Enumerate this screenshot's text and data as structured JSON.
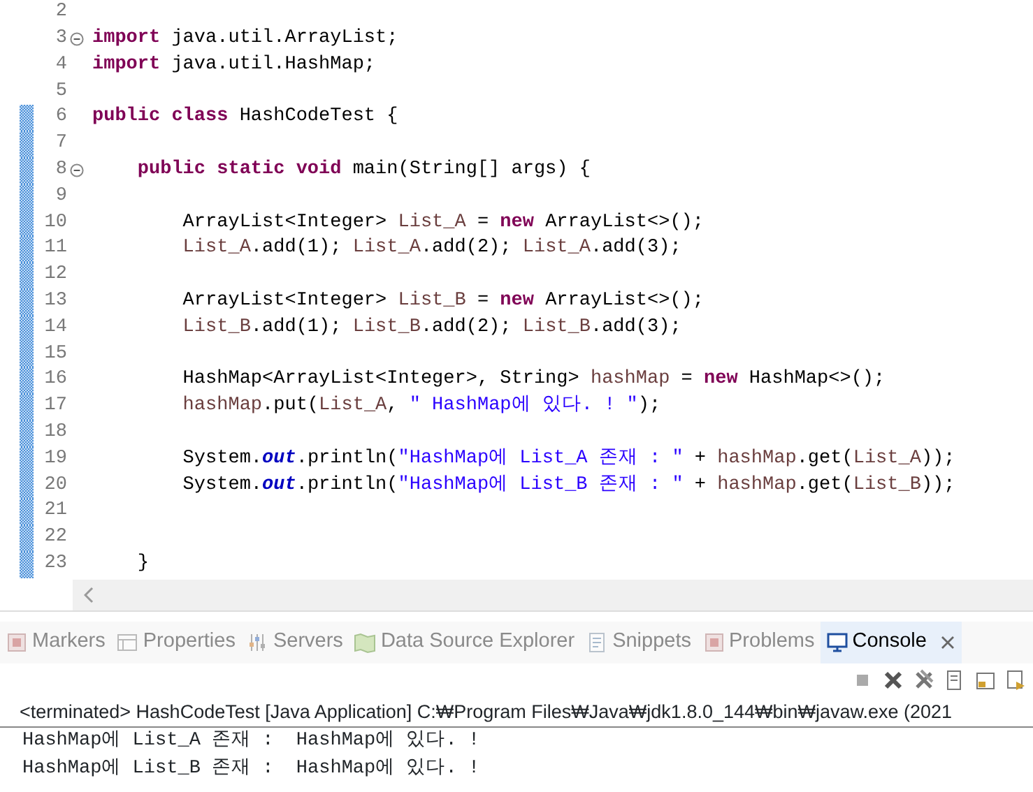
{
  "editor": {
    "lines": [
      {
        "number": "2",
        "fold": false,
        "changed": false
      },
      {
        "number": "3",
        "fold": true,
        "changed": false,
        "tokens": [
          {
            "kind": "keyword",
            "text": "import"
          },
          {
            "kind": "plain",
            "text": " java.util.ArrayList;"
          }
        ]
      },
      {
        "number": "4",
        "fold": false,
        "changed": false,
        "tokens": [
          {
            "kind": "keyword",
            "text": "import"
          },
          {
            "kind": "plain",
            "text": " java.util.HashMap;"
          }
        ]
      },
      {
        "number": "5",
        "fold": false,
        "changed": false
      },
      {
        "number": "6",
        "fold": false,
        "changed": true,
        "tokens": [
          {
            "kind": "keyword",
            "text": "public class"
          },
          {
            "kind": "plain",
            "text": " HashCodeTest {"
          }
        ]
      },
      {
        "number": "7",
        "fold": false,
        "changed": true
      },
      {
        "number": "8",
        "fold": true,
        "changed": true,
        "tokens": [
          {
            "kind": "keyword",
            "text": "    public static void"
          },
          {
            "kind": "plain",
            "text": " main(String[] args) {"
          }
        ]
      },
      {
        "number": "9",
        "fold": false,
        "changed": true
      },
      {
        "number": "10",
        "fold": false,
        "changed": true,
        "tokens": [
          {
            "kind": "plain",
            "text": "        ArrayList<Integer> "
          },
          {
            "kind": "variable",
            "text": "List_A"
          },
          {
            "kind": "plain",
            "text": " = "
          },
          {
            "kind": "keyword",
            "text": "new"
          },
          {
            "kind": "plain",
            "text": " ArrayList<>();"
          }
        ]
      },
      {
        "number": "11",
        "fold": false,
        "changed": true,
        "tokens": [
          {
            "kind": "variable",
            "text": "        List_A"
          },
          {
            "kind": "plain",
            "text": ".add(1); "
          },
          {
            "kind": "variable",
            "text": "List_A"
          },
          {
            "kind": "plain",
            "text": ".add(2); "
          },
          {
            "kind": "variable",
            "text": "List_A"
          },
          {
            "kind": "plain",
            "text": ".add(3);"
          }
        ]
      },
      {
        "number": "12",
        "fold": false,
        "changed": true
      },
      {
        "number": "13",
        "fold": false,
        "changed": true,
        "tokens": [
          {
            "kind": "plain",
            "text": "        ArrayList<Integer> "
          },
          {
            "kind": "variable",
            "text": "List_B"
          },
          {
            "kind": "plain",
            "text": " = "
          },
          {
            "kind": "keyword",
            "text": "new"
          },
          {
            "kind": "plain",
            "text": " ArrayList<>();"
          }
        ]
      },
      {
        "number": "14",
        "fold": false,
        "changed": true,
        "tokens": [
          {
            "kind": "variable",
            "text": "        List_B"
          },
          {
            "kind": "plain",
            "text": ".add(1); "
          },
          {
            "kind": "variable",
            "text": "List_B"
          },
          {
            "kind": "plain",
            "text": ".add(2); "
          },
          {
            "kind": "variable",
            "text": "List_B"
          },
          {
            "kind": "plain",
            "text": ".add(3);"
          }
        ]
      },
      {
        "number": "15",
        "fold": false,
        "changed": true
      },
      {
        "number": "16",
        "fold": false,
        "changed": true,
        "tokens": [
          {
            "kind": "plain",
            "text": "        HashMap<ArrayList<Integer>, String> "
          },
          {
            "kind": "variable",
            "text": "hashMap"
          },
          {
            "kind": "plain",
            "text": " = "
          },
          {
            "kind": "keyword",
            "text": "new"
          },
          {
            "kind": "plain",
            "text": " HashMap<>();"
          }
        ]
      },
      {
        "number": "17",
        "fold": false,
        "changed": true,
        "tokens": [
          {
            "kind": "variable",
            "text": "        hashMap"
          },
          {
            "kind": "plain",
            "text": ".put("
          },
          {
            "kind": "variable",
            "text": "List_A"
          },
          {
            "kind": "plain",
            "text": ", "
          },
          {
            "kind": "string",
            "text": "\" HashMap에 있다. ! \""
          },
          {
            "kind": "plain",
            "text": ");"
          }
        ]
      },
      {
        "number": "18",
        "fold": false,
        "changed": true
      },
      {
        "number": "19",
        "fold": false,
        "changed": true,
        "tokens": [
          {
            "kind": "plain",
            "text": "        System."
          },
          {
            "kind": "static",
            "text": "out"
          },
          {
            "kind": "plain",
            "text": ".println("
          },
          {
            "kind": "string",
            "text": "\"HashMap에 List_A 존재 : \""
          },
          {
            "kind": "plain",
            "text": " + "
          },
          {
            "kind": "variable",
            "text": "hashMap"
          },
          {
            "kind": "plain",
            "text": ".get("
          },
          {
            "kind": "variable",
            "text": "List_A"
          },
          {
            "kind": "plain",
            "text": "));"
          }
        ]
      },
      {
        "number": "20",
        "fold": false,
        "changed": true,
        "tokens": [
          {
            "kind": "plain",
            "text": "        System."
          },
          {
            "kind": "static",
            "text": "out"
          },
          {
            "kind": "plain",
            "text": ".println("
          },
          {
            "kind": "string",
            "text": "\"HashMap에 List_B 존재 : \""
          },
          {
            "kind": "plain",
            "text": " + "
          },
          {
            "kind": "variable",
            "text": "hashMap"
          },
          {
            "kind": "plain",
            "text": ".get("
          },
          {
            "kind": "variable",
            "text": "List_B"
          },
          {
            "kind": "plain",
            "text": "));"
          }
        ]
      },
      {
        "number": "21",
        "fold": false,
        "changed": true
      },
      {
        "number": "22",
        "fold": false,
        "changed": true
      },
      {
        "number": "23",
        "fold": false,
        "changed": true,
        "tokens": [
          {
            "kind": "plain",
            "text": "    }"
          }
        ]
      }
    ]
  },
  "views": {
    "tabs": [
      {
        "label": "Markers",
        "selected": false
      },
      {
        "label": "Properties",
        "selected": false
      },
      {
        "label": "Servers",
        "selected": false
      },
      {
        "label": "Data Source Explorer",
        "selected": false
      },
      {
        "label": "Snippets",
        "selected": false
      },
      {
        "label": "Problems",
        "selected": false
      },
      {
        "label": "Console",
        "selected": true
      }
    ]
  },
  "console": {
    "status": "<terminated> HashCodeTest [Java Application] C:₩Program Files₩Java₩jdk1.8.0_144₩bin₩javaw.exe (2021",
    "output": [
      "HashMap에 List_A 존재 :  HashMap에 있다. !",
      "HashMap에 List_B 존재 :  HashMap에 있다. !"
    ]
  }
}
